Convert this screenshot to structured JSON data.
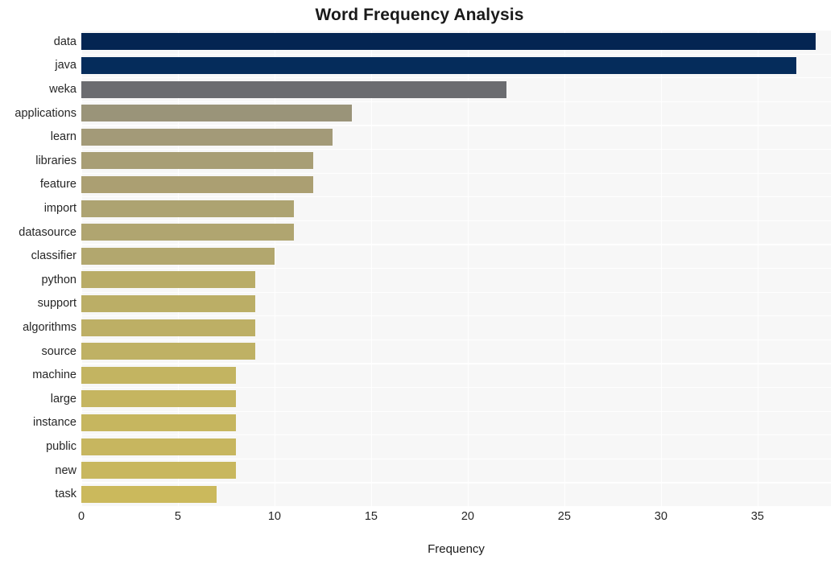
{
  "chart_data": {
    "type": "bar",
    "orientation": "horizontal",
    "title": "Word Frequency Analysis",
    "xlabel": "Frequency",
    "ylabel": "",
    "categories": [
      "data",
      "java",
      "weka",
      "applications",
      "learn",
      "libraries",
      "feature",
      "import",
      "datasource",
      "classifier",
      "python",
      "support",
      "algorithms",
      "source",
      "machine",
      "large",
      "instance",
      "public",
      "new",
      "task"
    ],
    "values": [
      38,
      37,
      22,
      14,
      13,
      12,
      12,
      11,
      11,
      10,
      9,
      9,
      9,
      9,
      8,
      8,
      8,
      8,
      8,
      7
    ],
    "bar_colors": [
      "#042552",
      "#052c5b",
      "#6b6c70",
      "#9a9479",
      "#a39a78",
      "#a89e75",
      "#ab9f72",
      "#ada371",
      "#b0a570",
      "#b2a76e",
      "#b9ac67",
      "#bbae66",
      "#bdaf65",
      "#bfb164",
      "#c3b461",
      "#c5b560",
      "#c6b65f",
      "#c7b65f",
      "#c8b75e",
      "#cbb95c"
    ],
    "xlim": [
      0,
      38.8
    ],
    "ylim_count": 20,
    "xticks": [
      0,
      5,
      10,
      15,
      20,
      25,
      30,
      35
    ],
    "xtick_labels": [
      "0",
      "5",
      "10",
      "15",
      "20",
      "25",
      "30",
      "35"
    ],
    "grid": true,
    "grid_color": "#ffffff",
    "plot_background": "#f7f7f7",
    "figure_background": "#ffffff",
    "legend": null,
    "annotations": []
  }
}
